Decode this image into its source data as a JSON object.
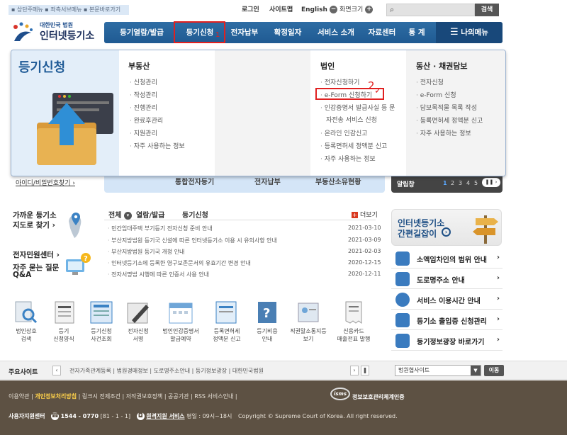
{
  "top": {
    "skip_links": "▪ 상단주메뉴 ▪ 좌측서브메뉴 ▪ 본문바로가기",
    "login": "로그인",
    "sitemap": "사이트맵",
    "english": "English",
    "zoom_label": "화면크기",
    "search_button": "검색"
  },
  "logo": {
    "small": "대한민국 법원",
    "big": "인터넷등기소"
  },
  "gnb": [
    "등기열람/발급",
    "등기신청",
    "전자납부",
    "확정일자",
    "서비스 소개",
    "자료센터",
    "통 계"
  ],
  "gnb_my": "나의메뉴",
  "annotation_1": "1",
  "annotation_2": "2",
  "mega": {
    "title": "등기신청",
    "columns": [
      {
        "header": "부동산",
        "items": [
          "신청관리",
          "작성관리",
          "진행관리",
          "완료후관리",
          "지원관리",
          "자주 사용하는 정보"
        ]
      },
      {
        "header": "법인",
        "items": [
          "전자신청하기",
          "e-Form 신청하기",
          "인감증명서 발급사실 등 문",
          "자전송 서비스 신청",
          "온라인 인감신고",
          "등록면허세 정액분 신고",
          "자주 사용하는 정보"
        ]
      },
      {
        "header": "동산 · 채권담보",
        "items": [
          "전자신청",
          "e-Form 신청",
          "담보목적물 목록 작성",
          "등록면허세 정액분 신고",
          "자주 사용하는 정보"
        ]
      }
    ]
  },
  "id_find": "아이디/비밀번호찾기 ›",
  "service_strip": [
    "통합전자등기",
    "전자납부",
    "부동산소유현황"
  ],
  "alarm": {
    "label": "알림창",
    "pages": [
      "1",
      "2",
      "3",
      "4",
      "5"
    ]
  },
  "left": {
    "near_registry": [
      "가까운 등기소",
      "지도로 찾기 ›"
    ],
    "civil_center": "전자민원센터 ›",
    "faq": [
      "자주 묻는 질문",
      "Q&A"
    ]
  },
  "notice": {
    "tabs": [
      "전체",
      "열람/발급",
      "등기신청"
    ],
    "more": "더보기",
    "rows": [
      {
        "title": "민간임대주택 부기등기 전자신청 준비 안내",
        "date": "2021-03-10"
      },
      {
        "title": "부산지방법원 등기국 신설에 따른 인터넷등기소 이용 시 유의사항 안내",
        "date": "2021-03-09"
      },
      {
        "title": "부산지방법원 등기국 개청 안내",
        "date": "2021-02-03"
      },
      {
        "title": "인터넷등기소에 등록한 영구보존문서의 유효기간 변경 안내",
        "date": "2020-12-15"
      },
      {
        "title": "전자서명법 시행에 따른 인증서 사용 안내",
        "date": "2020-12-11"
      }
    ]
  },
  "right": {
    "banner": [
      "인터넷등기소",
      "간편길잡이"
    ],
    "rows": [
      "소액임차인의 범위 안내",
      "도로명주소 안내",
      "서비스 이용시간 안내",
      "등기소 출입증 신청관리",
      "등기정보광장 바로가기"
    ]
  },
  "quick_icons": [
    [
      "법인상호",
      "검색"
    ],
    [
      "등기",
      "신청양식"
    ],
    [
      "등기신청",
      "사건조회"
    ],
    [
      "전자신청",
      "서명"
    ],
    [
      "법인인감증명서",
      "발급예약"
    ],
    [
      "등록면허세",
      "정액분 신고"
    ],
    [
      "등기비용",
      "안내"
    ],
    [
      "직권말소통지등",
      "보기"
    ],
    [
      "신용카드",
      "매출전표 발행"
    ]
  ],
  "sitebar": {
    "label": "주요사이트",
    "sites": "전자가족관계등록  |  법원경매정보  |  도로명주소안내  |  등기정보광장  |  대한민국법원",
    "select": "법원협사이트",
    "go": "이동"
  },
  "footer": {
    "links_pre": "이용약관  |",
    "privacy": "개인정보처리방침",
    "links_post": "|  링크시 전제조건  |  저작권보호정책  |  공공기관  |  RSS 서비스안내  |",
    "isms": "isms",
    "isms_text": "정보보호관리체계인증",
    "center": "사용자지원센터",
    "phone": "1544 - 0770",
    "phone_tail": "[81 - 1 - 1]",
    "remote": "원격지원 서비스",
    "hours": "평일 : 09시~18시",
    "copyright": "Copyright © Supreme Court of Korea. All right reserved."
  },
  "colors": {
    "nav": "#2e6da4",
    "accent_red": "#e02020",
    "footer": "#5d5143"
  }
}
